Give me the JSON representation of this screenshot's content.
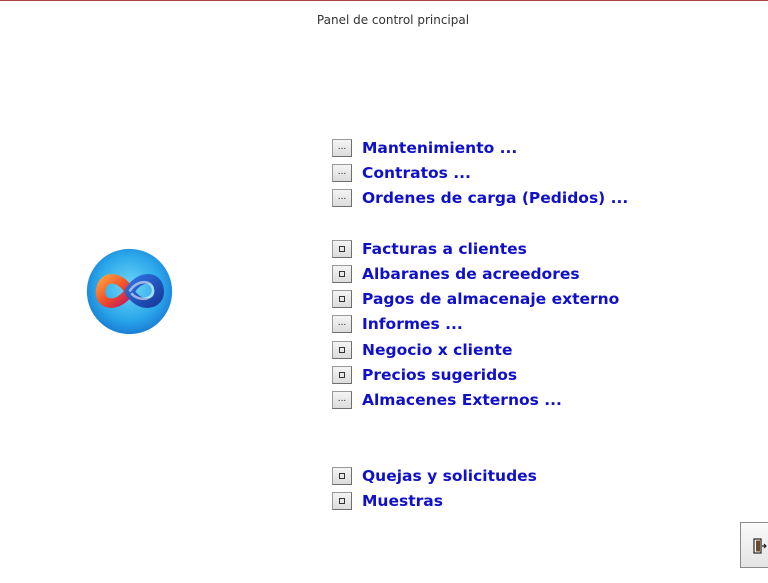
{
  "window": {
    "title": "Panel de control principal"
  },
  "logo": {
    "icon": "infinity-logo-icon",
    "colors": {
      "background_outer": "#1e8fe0",
      "background_inner": "#5fd0f5",
      "loop_warm": "#f25a2a",
      "loop_cool": "#1c4fb5"
    }
  },
  "menu": {
    "label_color": "#1010c8",
    "items": [
      {
        "label": "Mantenimiento ...",
        "button": "...",
        "type": "submenu"
      },
      {
        "label": "Contratos ...",
        "button": "...",
        "type": "submenu"
      },
      {
        "label": "Ordenes de carga (Pedidos) ...",
        "button": "...",
        "type": "submenu"
      },
      {
        "label": "Facturas a clientes",
        "button": "",
        "type": "form"
      },
      {
        "label": "Albaranes de acreedores",
        "button": "",
        "type": "form"
      },
      {
        "label": "Pagos de almacenaje externo",
        "button": "",
        "type": "form"
      },
      {
        "label": "Informes ...",
        "button": "...",
        "type": "submenu"
      },
      {
        "label": "Negocio x cliente",
        "button": "",
        "type": "form"
      },
      {
        "label": "Precios sugeridos",
        "button": "",
        "type": "form"
      },
      {
        "label": "Almacenes Externos ...",
        "button": "...",
        "type": "submenu"
      },
      {
        "label": "Quejas y solicitudes",
        "button": "",
        "type": "form"
      },
      {
        "label": "Muestras",
        "button": "",
        "type": "form"
      }
    ]
  },
  "exit": {
    "icon": "exit-door-icon"
  }
}
